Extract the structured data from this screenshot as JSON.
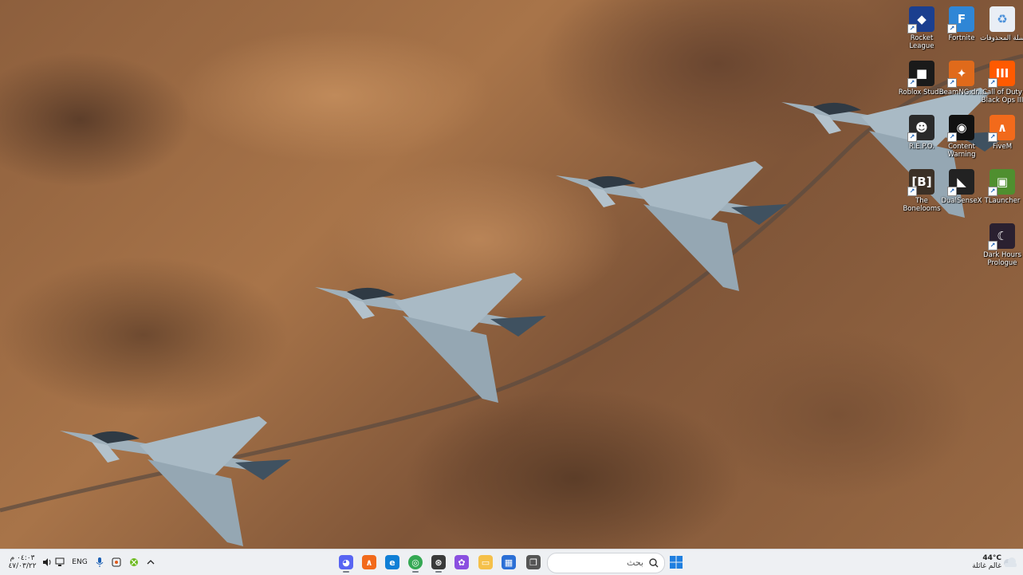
{
  "desktop": {
    "icons": [
      {
        "label": "Rocket League",
        "icon": "rocket-league-icon",
        "color": "#1b3f8f"
      },
      {
        "label": "Fortnite",
        "icon": "fortnite-icon",
        "color": "#2f86d6"
      },
      {
        "label": "سلة المحذوفات",
        "icon": "recycle-bin-icon",
        "color": "#e9eef5"
      },
      {
        "label": "Roblox Studio",
        "icon": "roblox-studio-icon",
        "color": "#1a1a1a"
      },
      {
        "label": "BeamNG.dr...",
        "icon": "beamng-icon",
        "color": "#e06a1b"
      },
      {
        "label": "Call of Duty Black Ops III",
        "icon": "call-of-duty-icon",
        "color": "#ff5a00"
      },
      {
        "label": "R.E.P.O.",
        "icon": "repo-icon",
        "color": "#2a2a2a"
      },
      {
        "label": "Content Warning",
        "icon": "content-warning-icon",
        "color": "#111111"
      },
      {
        "label": "FiveM",
        "icon": "fivem-icon",
        "color": "#f26a1b"
      },
      {
        "label": "The Bonelooms",
        "icon": "bonelab-icon",
        "color": "#3b3026"
      },
      {
        "label": "DualSenseX",
        "icon": "dualsensex-icon",
        "color": "#222222"
      },
      {
        "label": "TLauncher",
        "icon": "tlauncher-icon",
        "color": "#4f8f2f"
      },
      {
        "label": "Dark Hours Prologue",
        "icon": "dark-hours-icon",
        "color": "#2a2030"
      }
    ]
  },
  "taskbar": {
    "search_placeholder": "بحث",
    "apps": [
      {
        "name": "discord",
        "color": "#5865f2"
      },
      {
        "name": "fivem",
        "color": "#f26a1b"
      },
      {
        "name": "edge",
        "color": "#0f7fd6"
      },
      {
        "name": "chrome",
        "color": "#34a853"
      },
      {
        "name": "steam-like",
        "color": "#3a3a3a"
      },
      {
        "name": "copilot",
        "color": "#8a4fe0"
      },
      {
        "name": "file-explorer",
        "color": "#f5c04a"
      },
      {
        "name": "store",
        "color": "#2b6fd6"
      },
      {
        "name": "task-view",
        "color": "#555555"
      }
    ],
    "tray": {
      "time": "٠٤:٠٣ م",
      "date": "٤٧/٠٣/٢٢",
      "language": "ENG",
      "weather_temp": "44°C",
      "weather_text": "غالم غائلة"
    }
  }
}
